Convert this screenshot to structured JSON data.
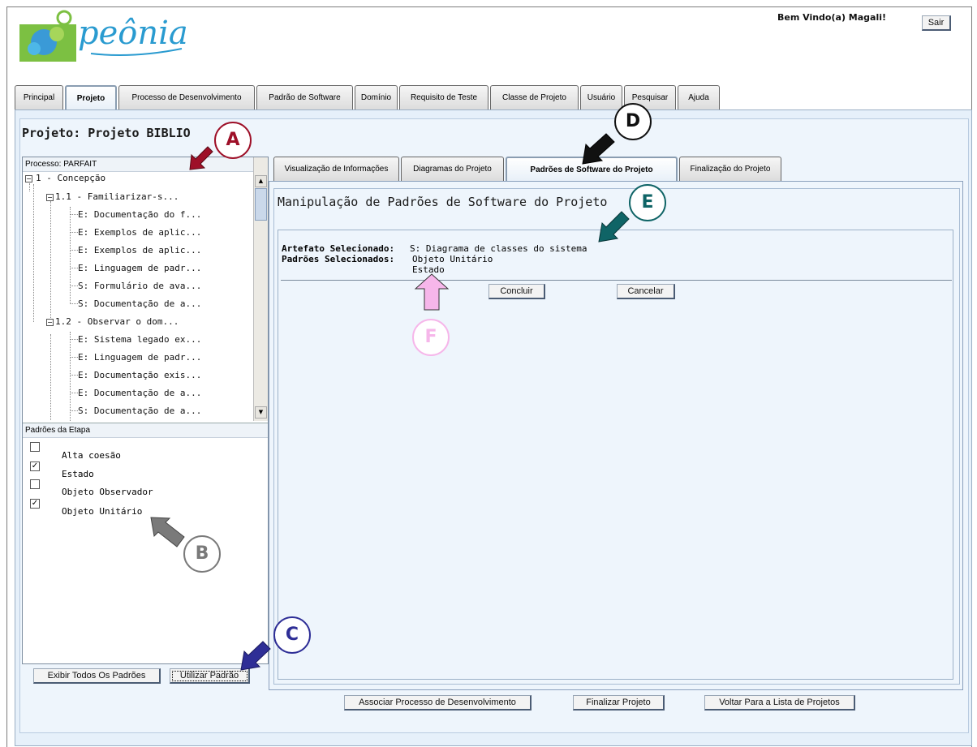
{
  "app": {
    "logo_text": "peônia",
    "welcome": "Bem Vindo(a) Magali!",
    "logout_label": "Sair"
  },
  "main_tabs": [
    {
      "label": "Principal"
    },
    {
      "label": "Projeto"
    },
    {
      "label": "Processo de Desenvolvimento"
    },
    {
      "label": "Padrão de Software"
    },
    {
      "label": "Domínio"
    },
    {
      "label": "Requisito de Teste"
    },
    {
      "label": "Classe de Projeto"
    },
    {
      "label": "Usuário"
    },
    {
      "label": "Pesquisar"
    },
    {
      "label": "Ajuda"
    }
  ],
  "project_title": "Projeto: Projeto BIBLIO",
  "process_panel": {
    "header": "Processo: PARFAIT",
    "tree": [
      {
        "label": "1 - Concepção"
      },
      {
        "label": "1.1 - Familiarizar-s..."
      },
      {
        "label": "E: Documentação do f..."
      },
      {
        "label": "E: Exemplos de aplic..."
      },
      {
        "label": "E: Exemplos de aplic..."
      },
      {
        "label": "E: Linguagem de padr..."
      },
      {
        "label": "S: Formulário de ava..."
      },
      {
        "label": "S: Documentação de a..."
      },
      {
        "label": "1.2 - Observar o dom..."
      },
      {
        "label": "E: Sistema legado ex..."
      },
      {
        "label": "E: Linguagem de padr..."
      },
      {
        "label": "E: Documentação exis..."
      },
      {
        "label": "E: Documentação de a..."
      },
      {
        "label": "S: Documentação de a..."
      }
    ]
  },
  "patterns_panel": {
    "header": "Padrões da Etapa",
    "items": [
      {
        "label": "Alta coesão",
        "checked": false
      },
      {
        "label": "Estado",
        "checked": true
      },
      {
        "label": "Objeto Observador",
        "checked": false
      },
      {
        "label": "Objeto Unitário",
        "checked": true
      }
    ],
    "show_all_label": "Exibir Todos Os Padrões",
    "use_label": "Utilizar Padrão"
  },
  "content_tabs": [
    {
      "label": "Visualização de Informações"
    },
    {
      "label": "Diagramas do Projeto"
    },
    {
      "label": "Padrões de Software do Projeto"
    },
    {
      "label": "Finalização do Projeto"
    }
  ],
  "content": {
    "title": "Manipulação de Padrões de Software do Projeto",
    "artifact_label": "Artefato Selecionado:",
    "artifact_value": "S: Diagrama de classes do sistema",
    "patterns_label": "Padrões Selecionados:",
    "patterns_values": [
      "Objeto Unitário",
      "Estado"
    ],
    "confirm_label": "Concluir",
    "cancel_label": "Cancelar"
  },
  "bottom_buttons": {
    "associate": "Associar Processo de Desenvolvimento",
    "finish": "Finalizar Projeto",
    "back": "Voltar Para a Lista de Projetos"
  },
  "annotations": {
    "a": "A",
    "b": "B",
    "c": "C",
    "d": "D",
    "e": "E",
    "f": "F"
  },
  "colors": {
    "annotation_a": "#9e1028",
    "annotation_b": "#7a7a7a",
    "annotation_c": "#2e2e96",
    "annotation_d": "#111111",
    "annotation_e": "#0f6466",
    "annotation_f": "#f6b6ea"
  }
}
